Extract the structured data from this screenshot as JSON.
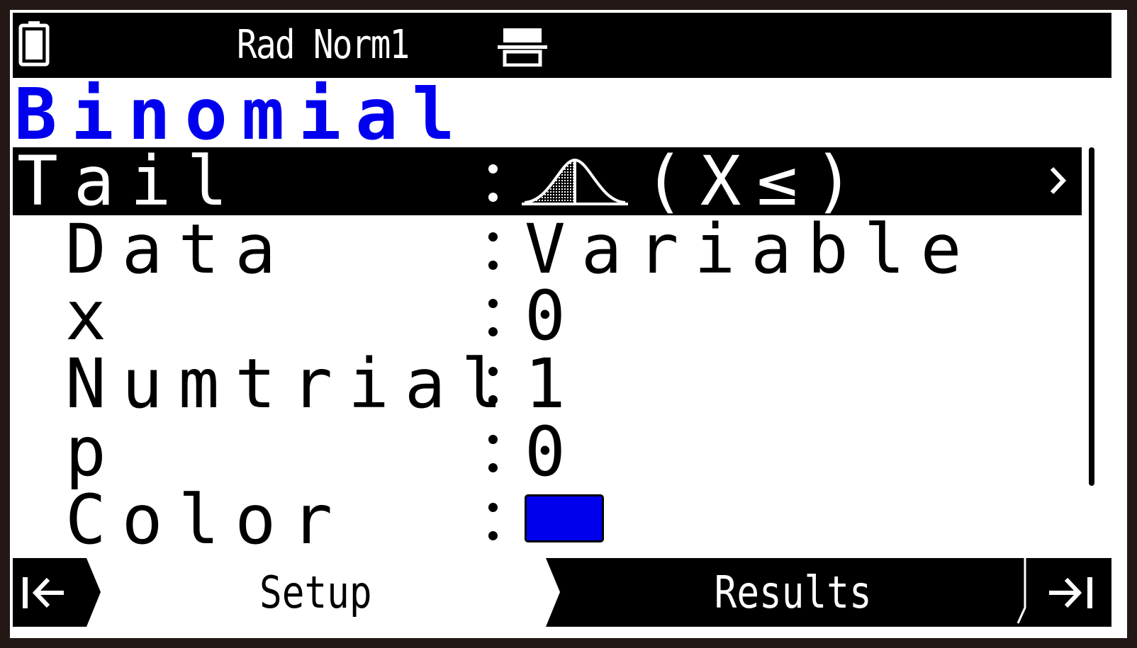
{
  "status_bar": {
    "text": "Rad Norm1",
    "battery_icon": "battery-icon",
    "input_icon": "input-mode-icon"
  },
  "title": "Binomial",
  "settings": [
    {
      "label": "Tail",
      "value": "(X≤)",
      "icon": "left-tail-distribution-icon",
      "selected": true
    },
    {
      "label": "Data",
      "value": "Variable"
    },
    {
      "label": "x",
      "value": "0"
    },
    {
      "label": "Numtrial",
      "value": "1"
    },
    {
      "label": "p",
      "value": "0"
    },
    {
      "label": "Color",
      "swatch": "#0000ee"
    }
  ],
  "tabs": {
    "first_icon": "jump-first-icon",
    "setup": "Setup",
    "results": "Results",
    "last_icon": "jump-last-icon",
    "active": "Setup"
  },
  "colors": {
    "title": "#0000ee",
    "selection": "#000000",
    "color_swatch": "#0000ee",
    "bezel": "#231815"
  }
}
